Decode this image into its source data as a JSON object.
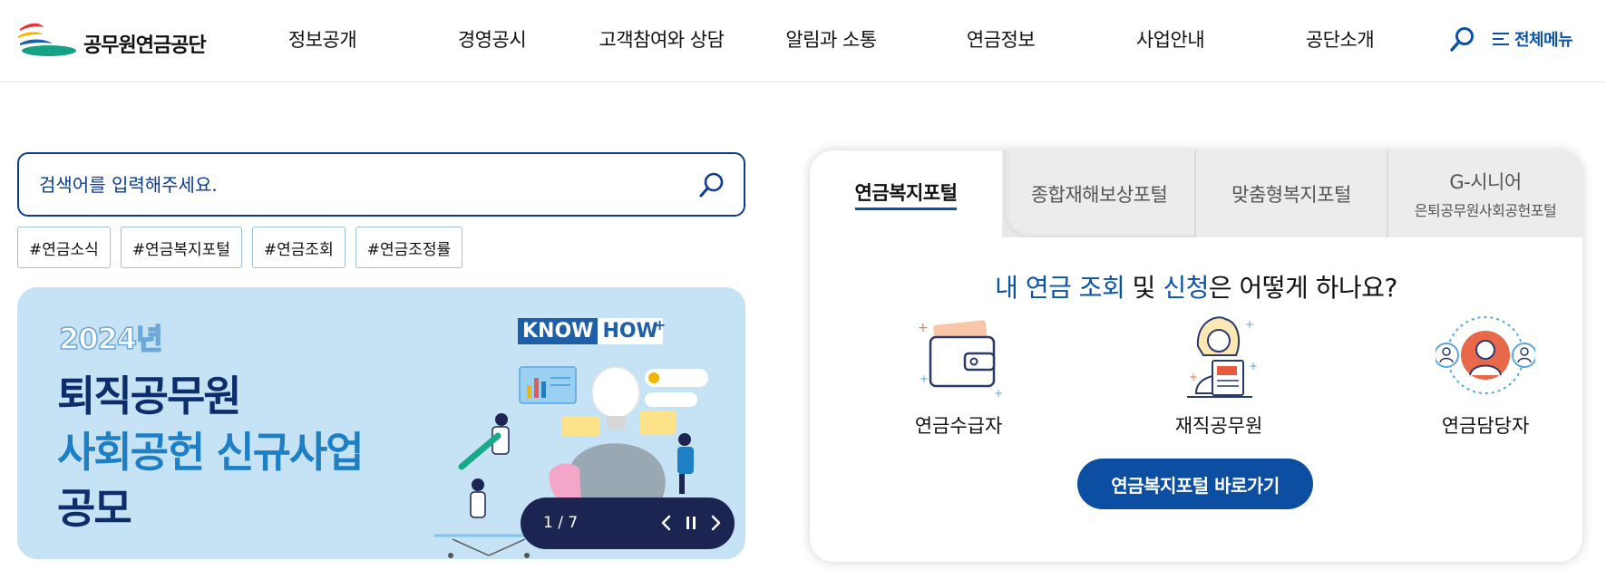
{
  "header": {
    "logo_text": "공무원연금공단",
    "nav": [
      "정보공개",
      "경영공시",
      "고객참여와 상담",
      "알림과 소통",
      "연금정보",
      "사업안내",
      "공단소개"
    ],
    "all_menu_label": "전체메뉴"
  },
  "search": {
    "placeholder": "검색어를 입력해주세요.",
    "tags": [
      "#연금소식",
      "#연금복지포털",
      "#연금조회",
      "#연금조정률"
    ]
  },
  "banner": {
    "year": "2024년",
    "line1": "퇴직공무원",
    "line2": "사회공헌 신규사업",
    "line3": "공모",
    "badge_a": "KNOW",
    "badge_b": "HOW",
    "badge_plus": "+",
    "pager": {
      "current": 1,
      "total": 7,
      "label": "1 / 7"
    }
  },
  "portal": {
    "tabs": [
      {
        "label": "연금복지포털",
        "sub": ""
      },
      {
        "label": "종합재해보상포털",
        "sub": ""
      },
      {
        "label": "맞춤형복지포털",
        "sub": ""
      },
      {
        "label": "G-시니어",
        "sub": "은퇴공무원사회공헌포털"
      }
    ],
    "active_tab": 0,
    "question": {
      "part1": "내 연금 조회",
      "part2": " 및 ",
      "part3": "신청",
      "part4": "은 어떻게 하나요?"
    },
    "choices": [
      "연금수급자",
      "재직공무원",
      "연금담당자"
    ],
    "button_label": "연금복지포털 바로가기"
  },
  "colors": {
    "brand_blue": "#0b53a4",
    "navy": "#0d2d6b",
    "banner_bg": "#c6e3f5",
    "pager_bg": "#1c2452"
  }
}
